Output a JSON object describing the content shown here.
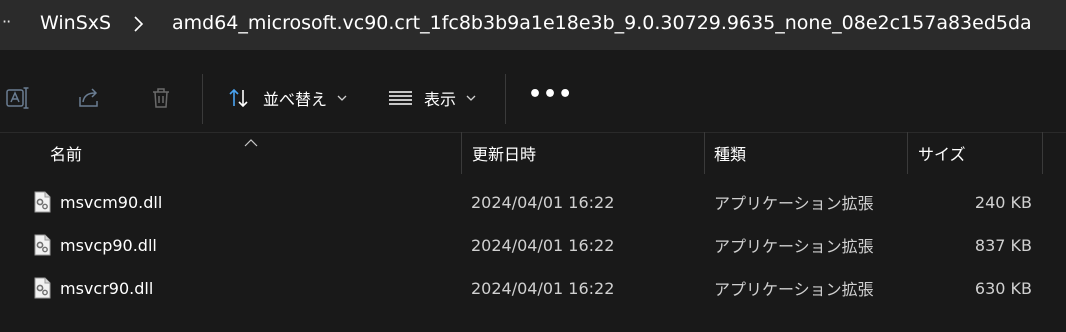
{
  "breadcrumb": {
    "more": "··",
    "items": [
      "WinSxS",
      "amd64_microsoft.vc90.crt_1fc8b3b9a1e18e3b_9.0.30729.9635_none_08e2c157a83ed5da"
    ]
  },
  "toolbar": {
    "sort_label": "並べ替え",
    "view_label": "表示",
    "more_label": "•••"
  },
  "columns": {
    "name": "名前",
    "date": "更新日時",
    "type": "種類",
    "size": "サイズ"
  },
  "files": [
    {
      "name": "msvcm90.dll",
      "date": "2024/04/01 16:22",
      "type": "アプリケーション拡張",
      "size": "240 KB"
    },
    {
      "name": "msvcp90.dll",
      "date": "2024/04/01 16:22",
      "type": "アプリケーション拡張",
      "size": "837 KB"
    },
    {
      "name": "msvcr90.dll",
      "date": "2024/04/01 16:22",
      "type": "アプリケーション拡張",
      "size": "630 KB"
    }
  ]
}
